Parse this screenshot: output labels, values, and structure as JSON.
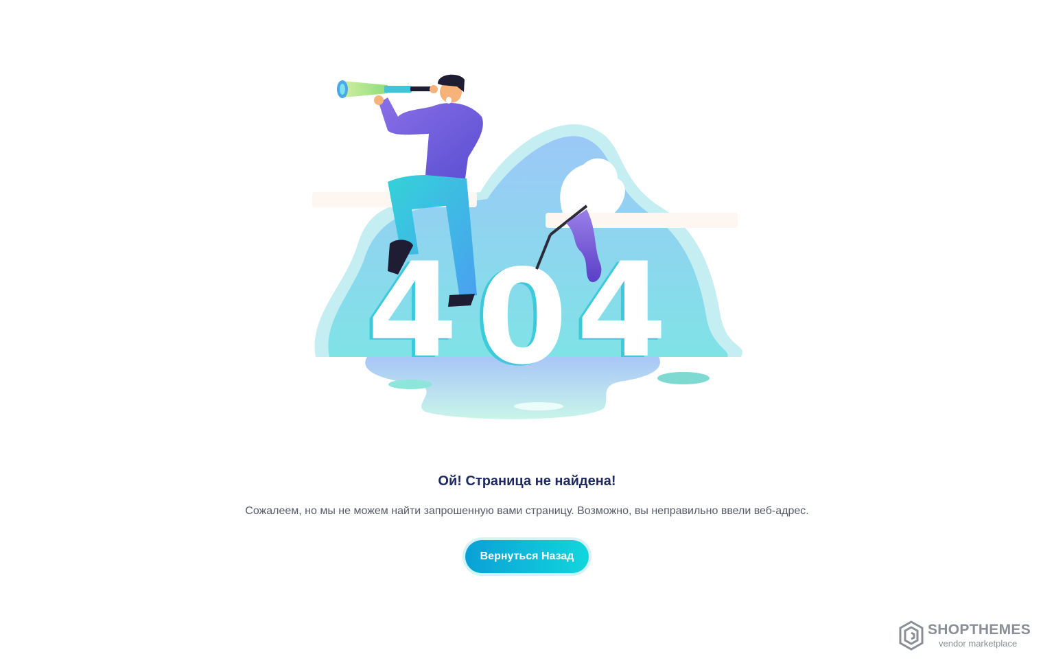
{
  "error": {
    "title": "Ой! Страница не найдена!",
    "message": "Сожалеем, но мы не можем найти запрошенную вами страницу. Возможно, вы неправильно ввели веб-адрес.",
    "back_button_label": "Вернуться Назад",
    "illustration_text": "404"
  },
  "branding": {
    "name": "SHOPTHEMES",
    "tagline": "vendor marketplace",
    "logo_icon": "hexagon-logo-icon"
  },
  "colors": {
    "title": "#1f2a60",
    "message": "#555a66",
    "button_gradient_start": "#0aa0d6",
    "button_gradient_end": "#12d6dc",
    "brand": "#8a8e96"
  }
}
